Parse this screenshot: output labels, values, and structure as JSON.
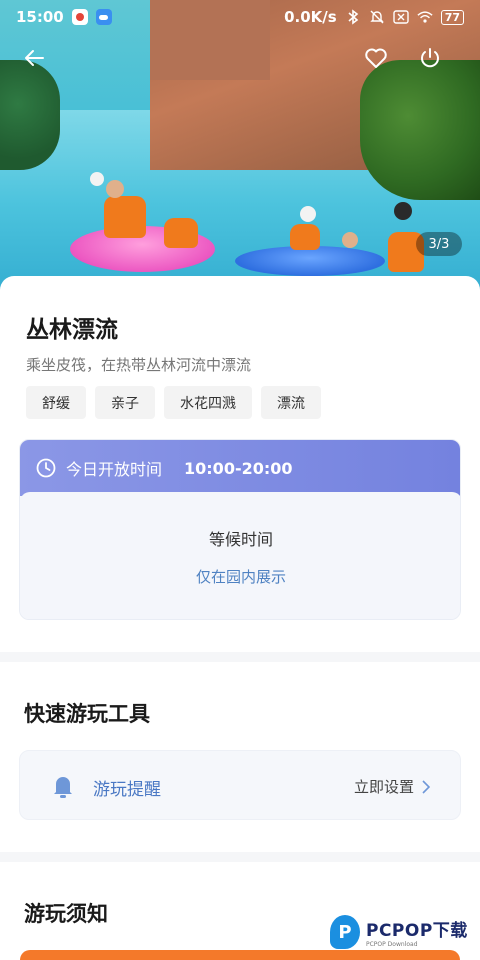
{
  "status_bar": {
    "time": "15:00",
    "network_speed": "0.0K/s",
    "battery": "77",
    "icons": [
      "app-icon",
      "cloud-app-icon",
      "bluetooth-icon",
      "mute-icon",
      "sim-icon",
      "wifi-icon",
      "battery-icon"
    ]
  },
  "hero": {
    "page_counter": "3/3"
  },
  "attraction": {
    "title": "丛林漂流",
    "description": "乘坐皮筏，在热带丛林河流中漂流",
    "tags": [
      "舒缓",
      "亲子",
      "水花四溅",
      "漂流"
    ]
  },
  "hours": {
    "label": "今日开放时间",
    "value": "10:00-20:00",
    "wait_title": "等候时间",
    "wait_note": "仅在园内展示"
  },
  "quick_tools": {
    "section_title": "快速游玩工具",
    "item_label": "游玩提醒",
    "item_action": "立即设置"
  },
  "notice": {
    "section_title": "游玩须知"
  },
  "watermark": {
    "brand": "PCPOP下载",
    "sub": "PCPOP Download"
  },
  "colors": {
    "accent_blue": "#4a78c4",
    "hours_gradient": "#7482df",
    "orange": "#f4792a"
  }
}
